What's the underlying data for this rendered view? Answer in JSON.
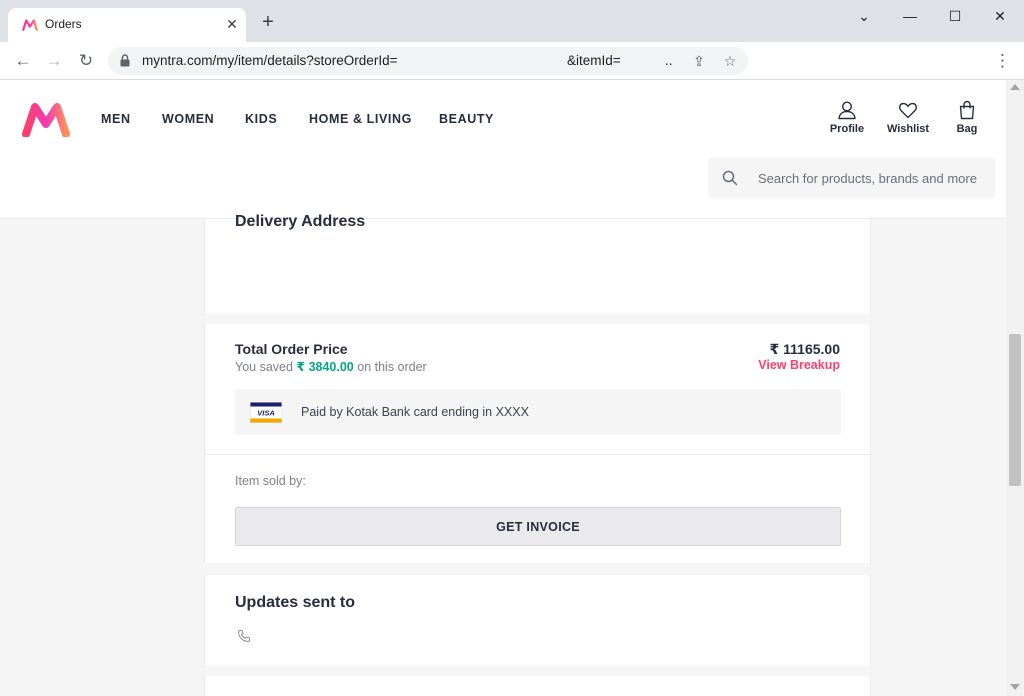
{
  "browser": {
    "tab_title": "Orders",
    "url_main": "myntra.com/my/item/details?storeOrderId=",
    "url_tail": "&itemId=",
    "url_ellipsis": ".."
  },
  "header": {
    "nav": [
      "MEN",
      "WOMEN",
      "KIDS",
      "HOME & LIVING",
      "BEAUTY"
    ],
    "actions": {
      "profile": "Profile",
      "wishlist": "Wishlist",
      "bag": "Bag"
    },
    "search_placeholder": "Search for products, brands and more"
  },
  "delivery": {
    "title": "Delivery Address"
  },
  "order": {
    "total_label": "Total Order Price",
    "saved_prefix": "You saved ",
    "saved_amount": "₹ 3840.00",
    "saved_suffix": " on this order",
    "total_amount": "₹ 11165.00",
    "view_breakup": "View Breakup",
    "payment_text": "Paid by Kotak Bank card ending in XXXX",
    "card_brand": "VISA",
    "sold_by": "Item sold by:",
    "invoice_button": "GET INVOICE"
  },
  "updates": {
    "title": "Updates sent to"
  },
  "colors": {
    "brand_pink": "#ff3f6c",
    "saved_green": "#03a685",
    "visa_blue": "#1a1f71",
    "visa_gold": "#f7a600"
  }
}
